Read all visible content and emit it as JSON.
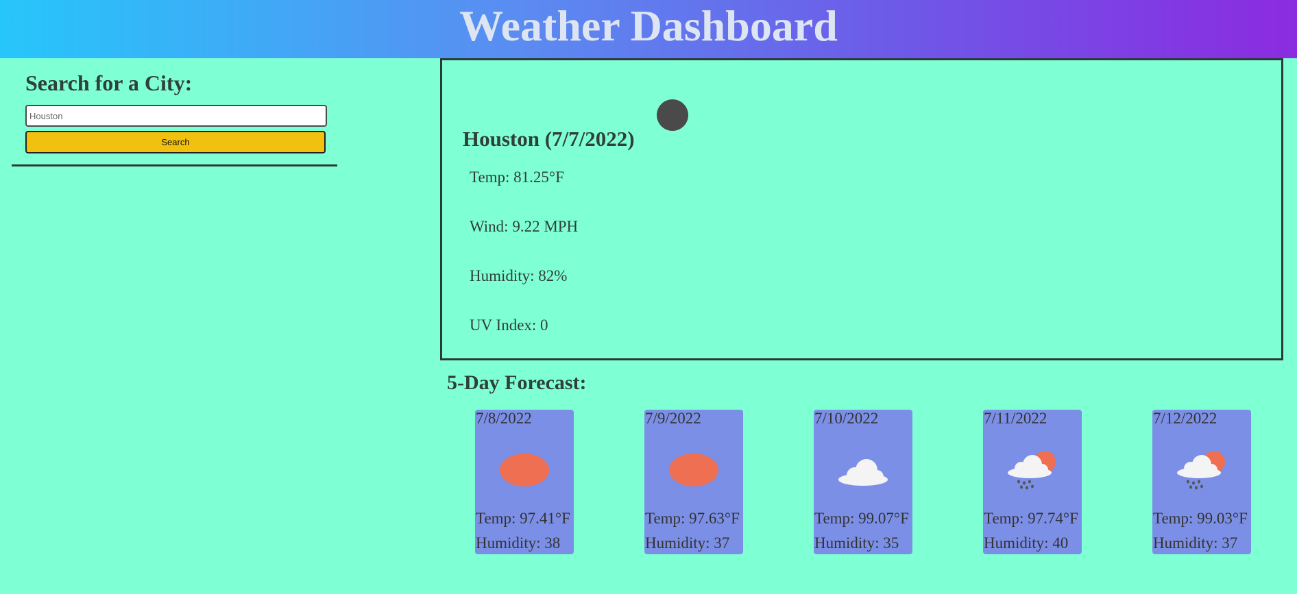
{
  "header": {
    "title": "Weather Dashboard"
  },
  "search": {
    "heading": "Search for a City:",
    "input_value": "Houston",
    "button_label": "Search"
  },
  "current": {
    "city_date": "Houston (7/7/2022)",
    "icon": "dark-circle-icon",
    "temp": "Temp: 81.25°F",
    "wind": "Wind: 9.22 MPH",
    "humidity": "Humidity: 82%",
    "uv": "UV Index: 0"
  },
  "forecast": {
    "title": "5-Day Forecast:",
    "days": [
      {
        "date": "7/8/2022",
        "icon": "sun-icon",
        "temp": "Temp: 97.41°F",
        "humidity": "Humidity: 38"
      },
      {
        "date": "7/9/2022",
        "icon": "sun-icon",
        "temp": "Temp: 97.63°F",
        "humidity": "Humidity: 37"
      },
      {
        "date": "7/10/2022",
        "icon": "cloud-icon",
        "temp": "Temp: 99.07°F",
        "humidity": "Humidity: 35"
      },
      {
        "date": "7/11/2022",
        "icon": "sun-rain-cloud-icon",
        "temp": "Temp: 97.74°F",
        "humidity": "Humidity: 40"
      },
      {
        "date": "7/12/2022",
        "icon": "sun-rain-cloud-icon",
        "temp": "Temp: 99.03°F",
        "humidity": "Humidity: 37"
      }
    ]
  },
  "colors": {
    "background": "#7fffd4",
    "button": "#f2c10f",
    "card": "#7b8fe7",
    "sun": "#ee6f51"
  }
}
